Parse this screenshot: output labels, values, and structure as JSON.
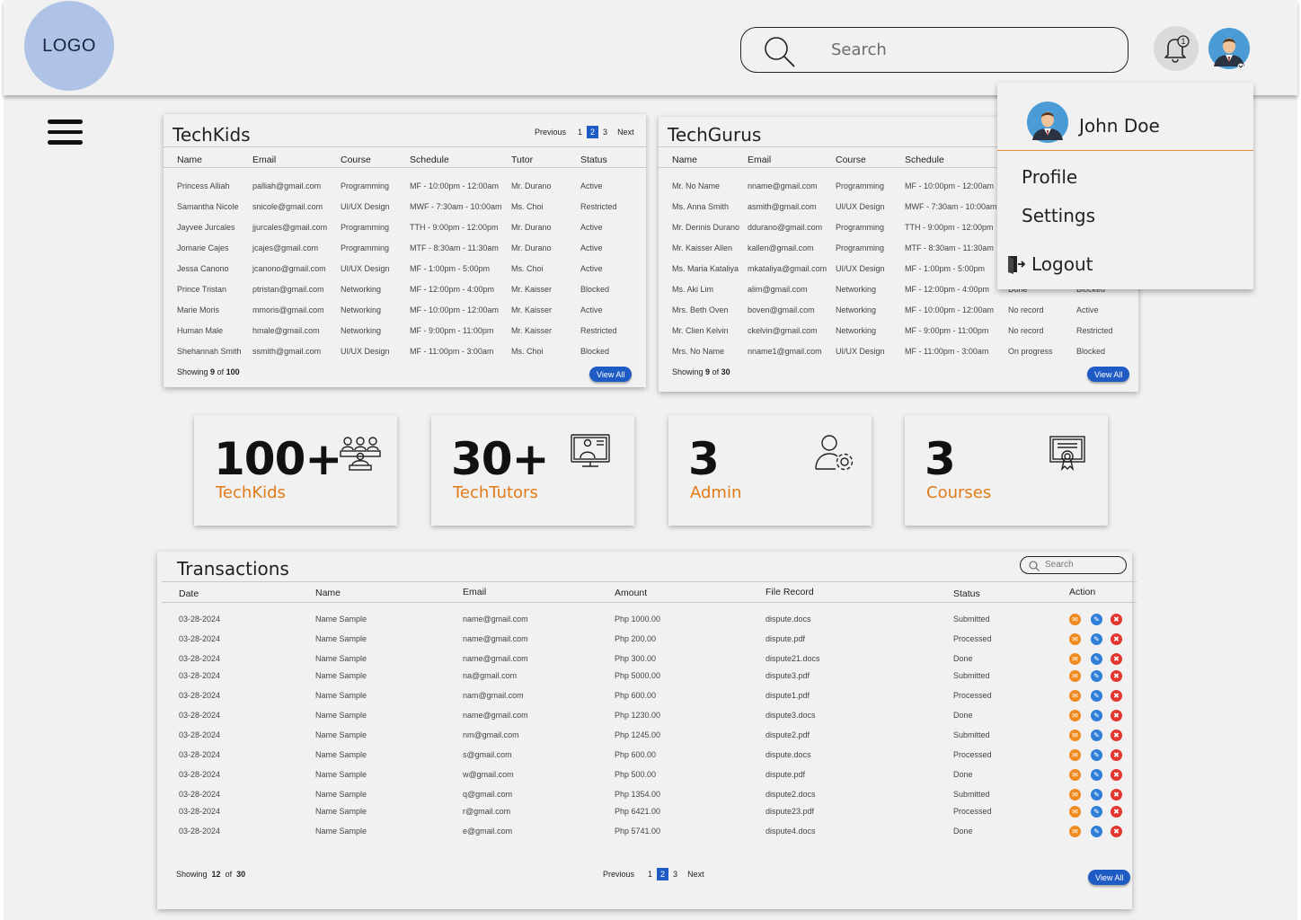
{
  "header": {
    "logo": "LOGO",
    "search_placeholder": "Search",
    "notification_count": "1"
  },
  "user_menu": {
    "name": "John Doe",
    "items": [
      "Profile",
      "Settings",
      "Logout"
    ]
  },
  "techkids": {
    "title": "TechKids",
    "pager": {
      "prev": "Previous",
      "pages": [
        "1",
        "2",
        "3"
      ],
      "active": "2",
      "next": "Next"
    },
    "columns": [
      "Name",
      "Email",
      "Course",
      "Schedule",
      "Tutor",
      "Status"
    ],
    "rows": [
      [
        "Princess Alliah",
        "palliah@gmail.com",
        "Programming",
        "MF - 10:00pm - 12:00am",
        "Mr. Durano",
        "Active"
      ],
      [
        "Samantha Nicole",
        "snicole@gmail.com",
        "UI/UX Design",
        "MWF - 7:30am - 10:00am",
        "Ms. Choi",
        "Restricted"
      ],
      [
        "Jayvee Jurcales",
        "jjurcales@gmail.com",
        "Programming",
        "TTH - 9:00pm - 12:00pm",
        "Mr. Durano",
        "Active"
      ],
      [
        "Jomarie Cajes",
        "jcajes@gmail.com",
        "Programming",
        "MTF - 8:30am - 11:30am",
        "Mr. Durano",
        "Active"
      ],
      [
        "Jessa Canono",
        "jcanono@gmail.com",
        "UI/UX Design",
        "MF - 1:00pm - 5:00pm",
        "Ms. Choi",
        "Active"
      ],
      [
        "Prince Tristan",
        "ptristan@gmail.com",
        "Networking",
        "MF - 12:00pm - 4:00pm",
        "Mr. Kaisser",
        "Blocked"
      ],
      [
        "Marie Moris",
        "mmoris@gmail.com",
        "Networking",
        "MF - 10:00pm - 12:00am",
        "Mr. Kaisser",
        "Active"
      ],
      [
        "Human Male",
        "hmale@gmail.com",
        "Networking",
        "MF - 9:00pm - 11:00pm",
        "Mr. Kaisser",
        "Restricted"
      ],
      [
        "Shehannah Smith",
        "ssmith@gmail.com",
        "UI/UX Design",
        "MF - 11:00pm - 3:00am",
        "Ms. Choi",
        "Blocked"
      ]
    ],
    "showing": {
      "prefix": "Showing",
      "count": "9",
      "of": "of",
      "total": "100"
    },
    "view_all": "View All"
  },
  "techgurus": {
    "title": "TechGurus",
    "columns": [
      "Name",
      "Email",
      "Course",
      "Schedule"
    ],
    "rows": [
      [
        "Mr. No Name",
        "nname@gmail.com",
        "Programming",
        "MF - 10:00pm - 12:00am",
        "",
        ""
      ],
      [
        "Ms. Anna Smith",
        "asmith@gmail.com",
        "UI/UX Design",
        "MWF - 7:30am - 10:00am",
        "",
        ""
      ],
      [
        "Mr. Dennis Durano",
        "ddurano@gmail.com",
        "Programming",
        "TTH - 9:00pm - 12:00pm",
        "",
        ""
      ],
      [
        "Mr. Kaisser Allen",
        "kallen@gmail.com",
        "Programming",
        "MTF - 8:30am - 11:30am",
        "",
        ""
      ],
      [
        "Ms. Maria Kataliya",
        "mkataliya@gmail.com",
        "UI/UX Design",
        "MF - 1:00pm - 5:00pm",
        "",
        ""
      ],
      [
        "Ms. Aki Lim",
        "alim@gmail.com",
        "Networking",
        "MF - 12:00pm - 4:00pm",
        "Done",
        "Blocked"
      ],
      [
        "Mrs. Beth Oven",
        "boven@gmail.com",
        "Networking",
        "MF - 10:00pm - 12:00am",
        "No record",
        "Active"
      ],
      [
        "Mr. Clien Kelvin",
        "ckelvin@gmail.com",
        "Networking",
        "MF - 9:00pm - 11:00pm",
        "No record",
        "Restricted"
      ],
      [
        "Mrs. No Name",
        "nname1@gmail.com",
        "UI/UX Design",
        "MF - 11:00pm - 3:00am",
        "On progress",
        "Blocked"
      ]
    ],
    "showing": {
      "prefix": "Showing",
      "count": "9",
      "of": "of",
      "total": "30"
    },
    "view_all": "View All"
  },
  "stats": [
    {
      "value": "100+",
      "label": "TechKids",
      "icon": "students-icon"
    },
    {
      "value": "30+",
      "label": "TechTutors",
      "icon": "tutor-icon"
    },
    {
      "value": "3",
      "label": "Admin",
      "icon": "admin-settings-icon"
    },
    {
      "value": "3",
      "label": "Courses",
      "icon": "certificate-icon"
    }
  ],
  "transactions": {
    "title": "Transactions",
    "search_placeholder": "Search",
    "columns": [
      "Date",
      "Name",
      "Email",
      "Amount",
      "File Record",
      "Status",
      "Action"
    ],
    "rows": [
      [
        "03-28-2024",
        "Name Sample",
        "name@gmail.com",
        "Php 1000.00",
        "dispute.docs",
        "Submitted"
      ],
      [
        "03-28-2024",
        "Name Sample",
        "name@gmail.com",
        "Php 200.00",
        "dispute.pdf",
        "Processed"
      ],
      [
        "03-28-2024",
        "Name Sample",
        "name@gmail.com",
        "Php 300.00",
        "dispute21.docs",
        "Done"
      ],
      [
        "03-28-2024",
        "Name Sample",
        "na@gmail.com",
        "Php 5000.00",
        "dispute3.pdf",
        "Submitted"
      ],
      [
        "03-28-2024",
        "Name Sample",
        "nam@gmail.com",
        "Php 600.00",
        "dispute1.pdf",
        "Processed"
      ],
      [
        "03-28-2024",
        "Name Sample",
        "name@gmail.com",
        "Php 1230.00",
        "dispute3.docs",
        "Done"
      ],
      [
        "03-28-2024",
        "Name Sample",
        "nm@gmail.com",
        "Php 1245.00",
        "dispute2.pdf",
        "Submitted"
      ],
      [
        "03-28-2024",
        "Name Sample",
        "s@gmail.com",
        "Php 600.00",
        "dispute.docs",
        "Processed"
      ],
      [
        "03-28-2024",
        "Name Sample",
        "w@gmail.com",
        "Php 500.00",
        "dispute.pdf",
        "Done"
      ],
      [
        "03-28-2024",
        "Name Sample",
        "q@gmail.com",
        "Php 1354.00",
        "dispute2.docs",
        "Submitted"
      ],
      [
        "03-28-2024",
        "Name Sample",
        "r@gmail.com",
        "Php 6421.00",
        "dispute23.pdf",
        "Processed"
      ],
      [
        "03-28-2024",
        "Name Sample",
        "e@gmail.com",
        "Php 5741.00",
        "dispute4.docs",
        "Done"
      ]
    ],
    "showing": {
      "prefix": "Showing",
      "count": "12",
      "of": "of",
      "total": "30"
    },
    "pager": {
      "prev": "Previous",
      "pages": [
        "1",
        "2",
        "3"
      ],
      "active": "2",
      "next": "Next"
    },
    "view_all": "View All"
  },
  "colors": {
    "accent_orange": "#e07b18",
    "primary_blue": "#1f5bc4",
    "logo_bg": "#aec3e6"
  }
}
